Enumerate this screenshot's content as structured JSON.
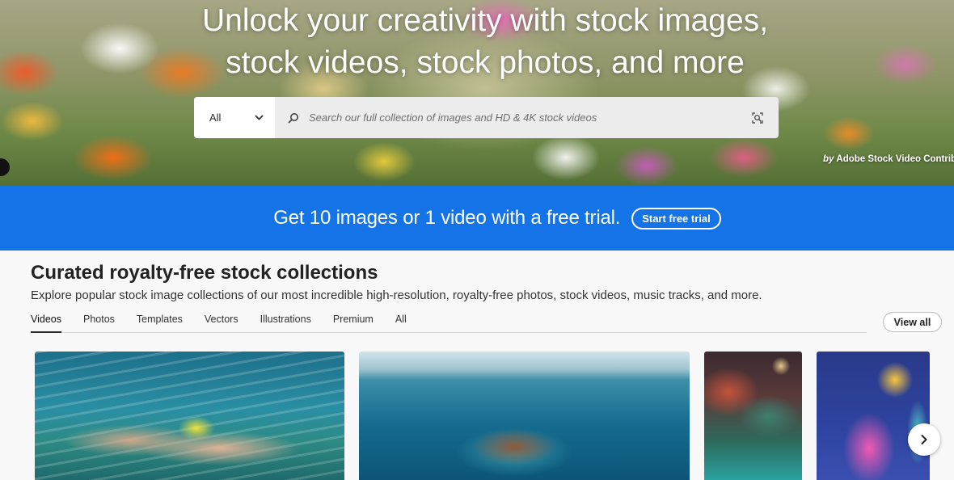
{
  "hero": {
    "title_line1": "Unlock your creativity with stock images,",
    "title_line2": "stock videos, stock photos, and more",
    "credit_by": "by",
    "credit_name": "Adobe Stock Video Contribu"
  },
  "search": {
    "type_label": "All",
    "placeholder": "Search our full collection of images and HD & 4K stock videos",
    "icons": {
      "search": "search-icon",
      "visual_search": "visual-search-icon",
      "dropdown": "chevron-down-icon"
    }
  },
  "promo": {
    "text": "Get 10 images or 1 video with a free trial.",
    "button_label": "Start free trial",
    "background_color": "#1473e6"
  },
  "collections": {
    "title": "Curated royalty-free stock collections",
    "subtitle": "Explore popular stock image collections of our most incredible high-resolution, royalty-free photos, stock videos, music tracks, and more.",
    "tabs": [
      {
        "label": "Videos",
        "active": true
      },
      {
        "label": "Photos",
        "active": false
      },
      {
        "label": "Templates",
        "active": false
      },
      {
        "label": "Vectors",
        "active": false
      },
      {
        "label": "Illustrations",
        "active": false
      },
      {
        "label": "Premium",
        "active": false
      },
      {
        "label": "All",
        "active": false
      }
    ],
    "view_all_label": "View all",
    "thumbnails": [
      {
        "subject": "underwater swimmer"
      },
      {
        "subject": "volcanic island in ocean"
      },
      {
        "subject": "cosmic scene with person"
      },
      {
        "subject": "pink cartoon monster with sun"
      }
    ],
    "next_icon": "chevron-right-icon"
  }
}
